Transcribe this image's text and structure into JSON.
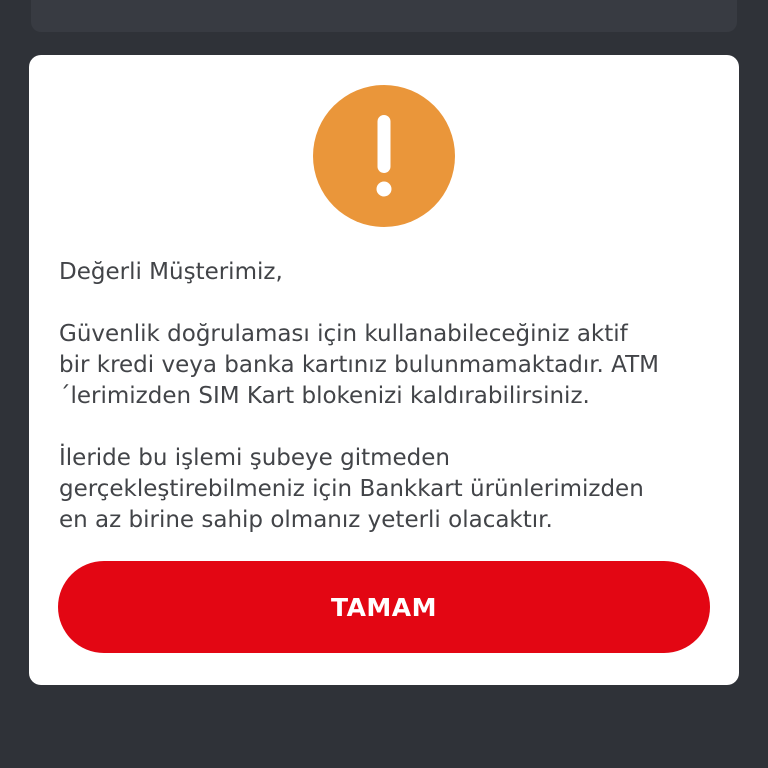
{
  "colors": {
    "backdrop": "#2f3238",
    "alert_accent": "#ea963a",
    "primary_button": "#e30613",
    "body_text": "#424448"
  },
  "dialog": {
    "icon": "exclamation-icon",
    "greeting": "Değerli Müşterimiz,",
    "paragraph1": "Güvenlik doğrulaması için kullanabileceğiniz aktif\nbir kredi veya banka kartınız bulunmamaktadır. ATM\n´lerimizden SIM Kart blokenizi kaldırabilirsiniz.",
    "paragraph2": "İleride bu işlemi şubeye gitmeden\ngerçekleştirebilmeniz için Bankkart ürünlerimizden\nen az birine sahip olmanız yeterli olacaktır.",
    "confirm_label": "TAMAM"
  }
}
